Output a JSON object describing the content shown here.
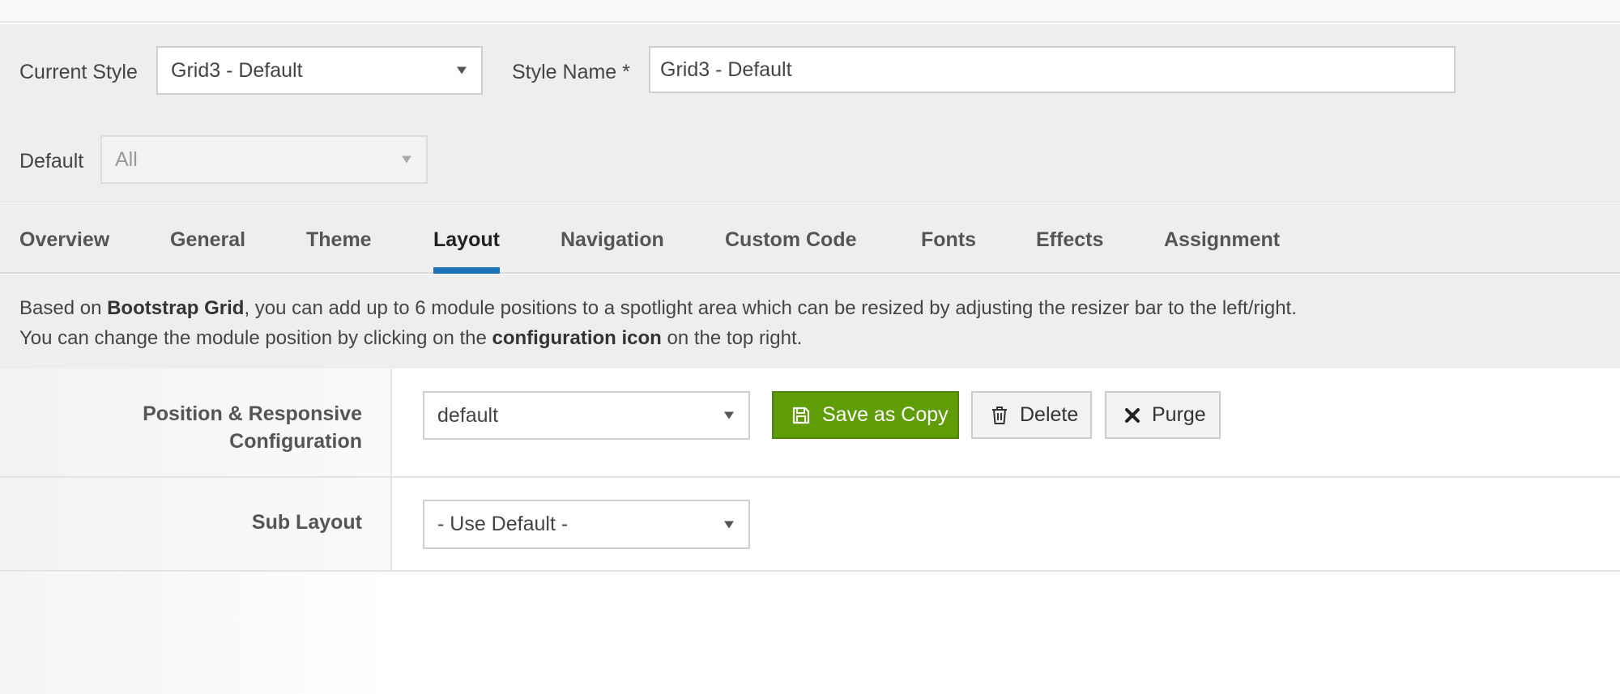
{
  "header": {
    "current_style_label": "Current Style",
    "current_style_value": "Grid3 - Default",
    "style_name_label": "Style Name *",
    "style_name_value": "Grid3 - Default",
    "default_label": "Default",
    "default_value": "All"
  },
  "tabs": [
    {
      "label": "Overview",
      "active": false
    },
    {
      "label": "General",
      "active": false
    },
    {
      "label": "Theme",
      "active": false
    },
    {
      "label": "Layout",
      "active": true
    },
    {
      "label": "Navigation",
      "active": false
    },
    {
      "label": "Custom Code",
      "active": false
    },
    {
      "label": "Fonts",
      "active": false
    },
    {
      "label": "Effects",
      "active": false
    },
    {
      "label": "Assignment",
      "active": false
    }
  ],
  "info": {
    "line1_pre": "Based on ",
    "line1_bold": "Bootstrap Grid",
    "line1_post": ", you can add up to 6 module positions to a spotlight area which can be resized by adjusting the resizer bar to the left/right.",
    "line2_pre": "You can change the module position by clicking on the ",
    "line2_bold": "configuration icon",
    "line2_post": " on the top right."
  },
  "layout_form": {
    "position_label_line1": "Position & Responsive",
    "position_label_line2": "Configuration",
    "position_value": "default",
    "save_copy_label": "Save as Copy",
    "delete_label": "Delete",
    "purge_label": "Purge",
    "sub_layout_label": "Sub Layout",
    "sub_layout_value": "- Use Default -"
  },
  "colors": {
    "accent_tab": "#1d73b8",
    "save_button": "#5f9d06"
  },
  "icons": {
    "save": "floppy-disk-icon",
    "delete": "trash-icon",
    "purge": "x-icon",
    "dropdown": "caret-down-icon"
  }
}
